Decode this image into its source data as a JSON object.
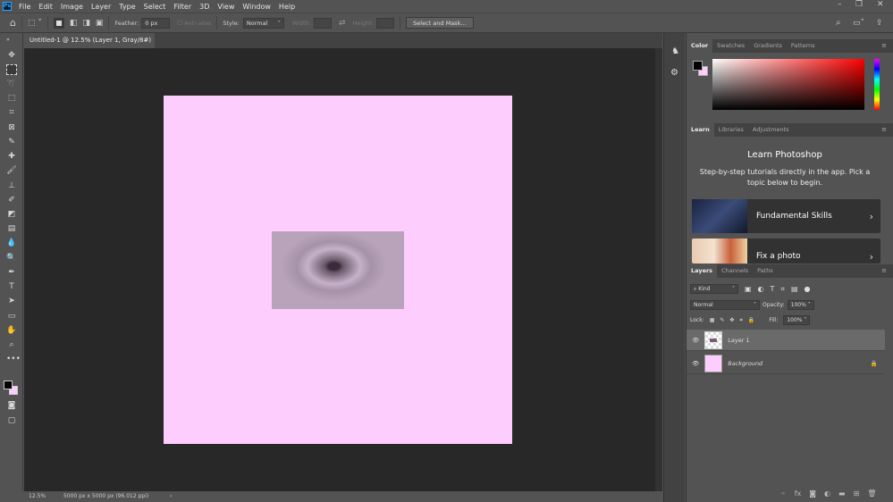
{
  "app": {
    "logo": "Ps",
    "menus": [
      "File",
      "Edit",
      "Image",
      "Layer",
      "Type",
      "Select",
      "Filter",
      "3D",
      "View",
      "Window",
      "Help"
    ],
    "window_controls": [
      "–",
      "❐",
      "✕"
    ]
  },
  "options": {
    "feather_label": "Feather:",
    "feather_value": "0 px",
    "antialias_label": "Anti-alias",
    "style_label": "Style:",
    "style_value": "Normal",
    "width_label": "Width:",
    "height_label": "Height:",
    "select_mask": "Select and Mask..."
  },
  "document_tab": {
    "title": "Untitled-1 @ 12.5% (Layer 1, Gray/8#) *",
    "close": "×"
  },
  "status": {
    "zoom": "12.5%",
    "info": "5000 px x 5000 px (96.012 ppi)",
    "arrow": "›"
  },
  "color_panel": {
    "tabs": [
      "Color",
      "Swatches",
      "Gradients",
      "Patterns"
    ],
    "foreground": "#000000",
    "background": "#fdcdfd"
  },
  "learn_panel": {
    "tabs": [
      "Learn",
      "Libraries",
      "Adjustments"
    ],
    "title": "Learn Photoshop",
    "subtitle": "Step-by-step tutorials directly in the app. Pick a topic below to begin.",
    "cards": [
      {
        "label": "Fundamental Skills"
      },
      {
        "label": "Fix a photo"
      }
    ]
  },
  "layers_panel": {
    "tabs": [
      "Layers",
      "Channels",
      "Paths"
    ],
    "filter": "Kind",
    "blend_mode": "Normal",
    "opacity_label": "Opacity:",
    "opacity": "100%",
    "lock_label": "Lock:",
    "fill_label": "Fill:",
    "fill": "100%",
    "layers": [
      {
        "name": "Layer 1",
        "selected": true
      },
      {
        "name": "Background",
        "locked": true
      }
    ]
  }
}
